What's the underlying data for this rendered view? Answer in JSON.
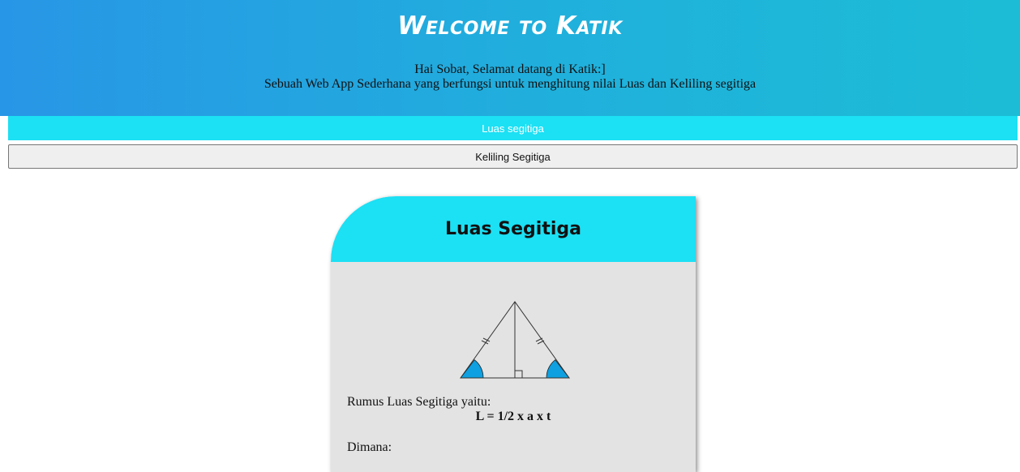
{
  "header": {
    "title": "Welcome to Katik",
    "greeting": "Hai Sobat, Selamat datang di Katik:]",
    "description": "Sebuah Web App Sederhana yang berfungsi untuk menghitung nilai Luas dan Keliling segitiga"
  },
  "buttons": {
    "luas": "Luas segitiga",
    "keliling": "Keliling Segitiga"
  },
  "card": {
    "title": "Luas Segitiga",
    "formula_label": "Rumus Luas Segitiga yaitu:",
    "formula": "L = 1/2 x a x t",
    "dimana": "Dimana:"
  },
  "colors": {
    "accent": "#1ce0f4",
    "angle_fill": "#0ea0e0"
  }
}
